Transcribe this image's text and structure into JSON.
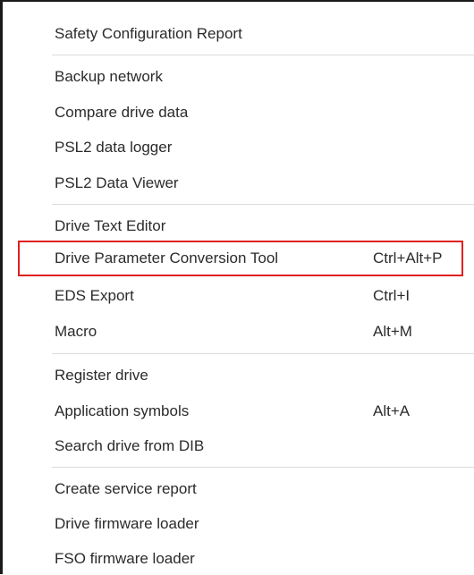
{
  "menu": {
    "items": [
      {
        "label": "Safety Configuration Report",
        "shortcut": ""
      },
      {
        "label": "Backup network",
        "shortcut": ""
      },
      {
        "label": "Compare drive data",
        "shortcut": ""
      },
      {
        "label": "PSL2 data logger",
        "shortcut": ""
      },
      {
        "label": "PSL2 Data Viewer",
        "shortcut": ""
      },
      {
        "label": "Drive Text Editor",
        "shortcut": ""
      },
      {
        "label": "Drive Parameter Conversion Tool",
        "shortcut": "Ctrl+Alt+P"
      },
      {
        "label": "EDS Export",
        "shortcut": "Ctrl+I"
      },
      {
        "label": "Macro",
        "shortcut": "Alt+M"
      },
      {
        "label": "Register drive",
        "shortcut": ""
      },
      {
        "label": "Application symbols",
        "shortcut": "Alt+A"
      },
      {
        "label": "Search drive from DIB",
        "shortcut": ""
      },
      {
        "label": "Create service report",
        "shortcut": ""
      },
      {
        "label": "Drive firmware loader",
        "shortcut": ""
      },
      {
        "label": "FSO firmware loader",
        "shortcut": ""
      }
    ]
  },
  "colors": {
    "highlight_border": "#e02020",
    "text": "#2b2b2b",
    "separator": "#dcdcdc"
  }
}
